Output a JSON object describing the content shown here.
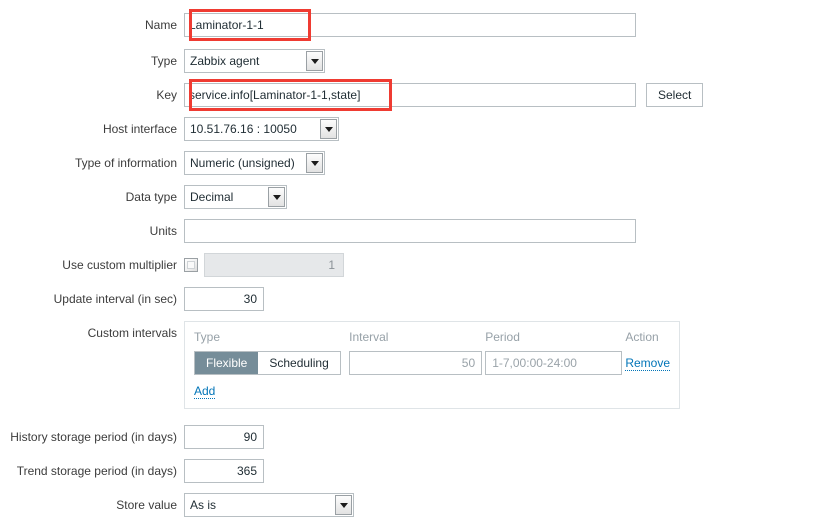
{
  "form": {
    "rows": {
      "name": {
        "label": "Name",
        "value": "Laminator-1-1",
        "placeholder": ""
      },
      "type": {
        "label": "Type",
        "value": "Zabbix agent"
      },
      "key": {
        "label": "Key",
        "value": "service.info[Laminator-1-1,state]",
        "placeholder": "",
        "select_button": "Select"
      },
      "host_interface": {
        "label": "Host interface",
        "value": "10.51.76.16 : 10050"
      },
      "type_of_information": {
        "label": "Type of information",
        "value": "Numeric (unsigned)"
      },
      "data_type": {
        "label": "Data type",
        "value": "Decimal"
      },
      "units": {
        "label": "Units",
        "value": "",
        "placeholder": ""
      },
      "use_custom_multiplier": {
        "label": "Use custom multiplier",
        "checked": false,
        "value": "",
        "placeholder": "1"
      },
      "update_interval": {
        "label": "Update interval (in sec)",
        "value": "30"
      },
      "custom_intervals": {
        "label": "Custom intervals",
        "headers": [
          "Type",
          "Interval",
          "Period",
          "Action"
        ],
        "rows": [
          {
            "type_options": [
              "Flexible",
              "Scheduling"
            ],
            "type_selected": "Flexible",
            "interval_value": "",
            "interval_placeholder": "50",
            "period_value": "",
            "period_placeholder": "1-7,00:00-24:00",
            "action": "Remove"
          }
        ],
        "add_label": "Add"
      },
      "history_storage_period": {
        "label": "History storage period (in days)",
        "value": "90"
      },
      "trend_storage_period": {
        "label": "Trend storage period (in days)",
        "value": "365"
      },
      "store_value": {
        "label": "Store value",
        "value": "As is"
      }
    }
  },
  "annotations": {
    "highlight_color": "#ef3b32",
    "boxes": [
      "name-field",
      "key-field"
    ]
  },
  "colors": {
    "link": "#0275b8",
    "toggle_active_bg": "#768d99",
    "label_text": "#3c3c3c",
    "muted_text": "#97a1a8",
    "input_border": "#b8bfc3"
  },
  "icons": {
    "dropdown": "chevron-down-icon"
  }
}
